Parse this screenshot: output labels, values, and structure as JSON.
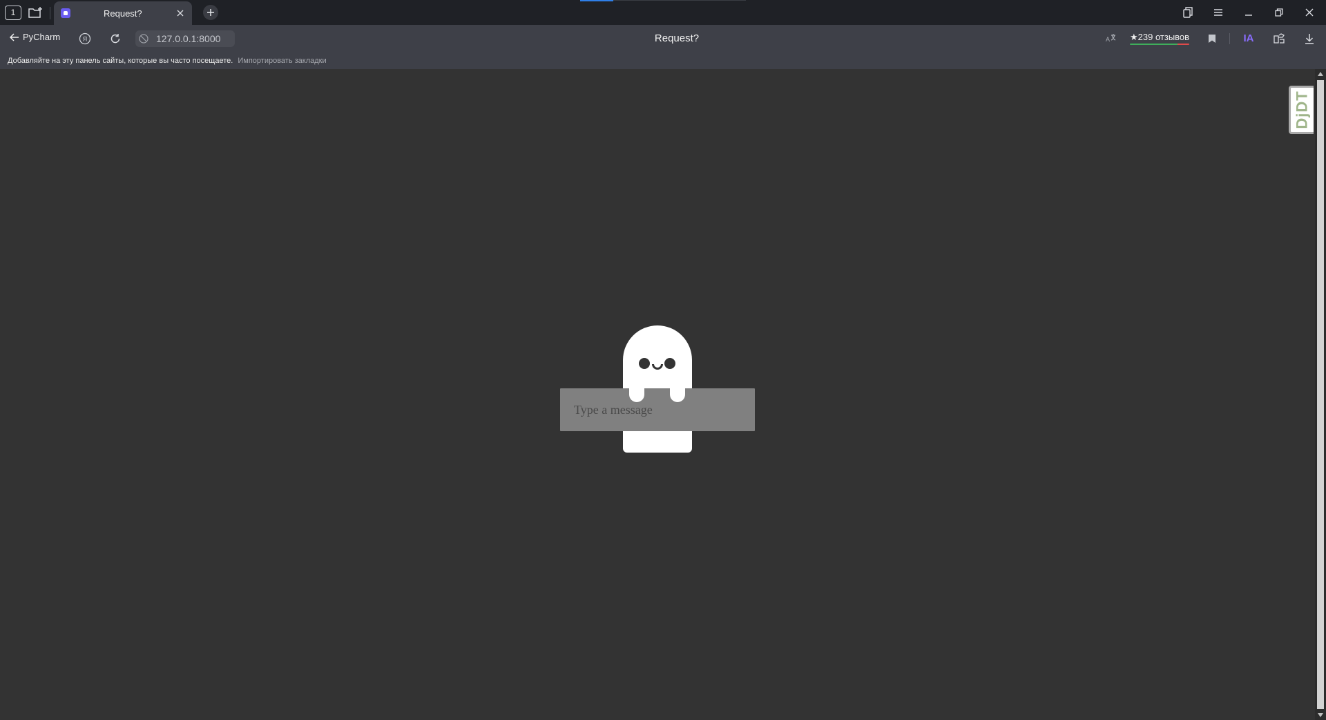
{
  "browser": {
    "tab_count": "1",
    "active_tab": {
      "title": "Request?"
    },
    "back_label": "PyCharm",
    "address": "127.0.0.1:8000",
    "page_title": "Request?",
    "reviews_label": "★239 отзывов",
    "extension_label": "IA",
    "bookmarks_hint": "Добавляйте на эту панель сайты, которые вы часто посещаете.",
    "bookmarks_import": "Импортировать закладки"
  },
  "page": {
    "message_placeholder": "Type a message",
    "debug_toolbar_label": "DjDT"
  },
  "colors": {
    "page_background": "#333333",
    "ghost": "#ffffff",
    "input_background": "#808080",
    "tab_favicon": "#6a5cf0",
    "debug_toolbar_text": "#9fb58a"
  }
}
